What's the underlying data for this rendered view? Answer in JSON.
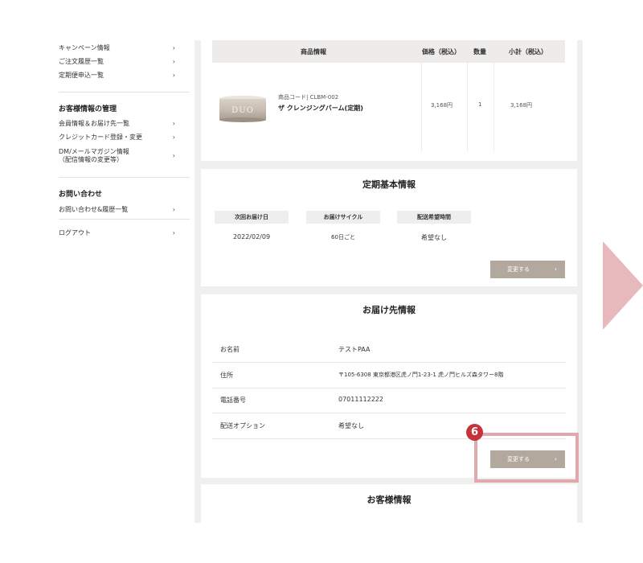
{
  "sidebar": {
    "top_items": [
      {
        "label": "キャンペーン情報",
        "chevron": "›"
      },
      {
        "label": "ご注文履歴一覧",
        "chevron": "›"
      },
      {
        "label": "定期便申込一覧",
        "chevron": "›"
      }
    ],
    "customer_heading": "お客様情報の管理",
    "customer_items": [
      {
        "label": "会員情報＆お届け先一覧",
        "chevron": "›"
      },
      {
        "label": "クレジットカード登録・変更",
        "chevron": "›"
      },
      {
        "label": "DM/メールマガジン情報",
        "sub": "（配信情報の変更等）",
        "chevron": "›"
      }
    ],
    "contact_heading": "お問い合わせ",
    "contact_items": [
      {
        "label": "お問い合わせ&履歴一覧",
        "chevron": "›"
      }
    ],
    "logout": {
      "label": "ログアウト",
      "chevron": "›"
    }
  },
  "product_table": {
    "headers": {
      "info": "商品情報",
      "price": "価格（税込）",
      "qty": "数量",
      "subtotal": "小計（税込）"
    },
    "row": {
      "code": "商品コード| CLBM-002",
      "name": "ザ クレンジングバーム(定期)",
      "price": "3,168円",
      "qty": "1",
      "subtotal": "3,168円",
      "image_brand": "DUO"
    }
  },
  "subscription": {
    "title": "定期基本情報",
    "fields": [
      {
        "label": "次回お届け日",
        "value": "2022/02/09"
      },
      {
        "label": "お届けサイクル",
        "value": "60日ごと"
      },
      {
        "label": "配送希望時間",
        "value": "希望なし"
      }
    ],
    "change_button": "変更する",
    "chevron": "›"
  },
  "delivery": {
    "title": "お届け先情報",
    "rows": [
      {
        "label": "お名前",
        "value": "テストPAA"
      },
      {
        "label": "住所",
        "value": "〒105-6308 東京都港区虎ノ門1-23-1 虎ノ門ヒルズ森タワー8階"
      },
      {
        "label": "電話番号",
        "value": "07011112222"
      },
      {
        "label": "配送オプション",
        "value": "希望なし"
      }
    ],
    "change_button": "変更する",
    "chevron": "›"
  },
  "customer_info": {
    "title": "お客様情報"
  },
  "annotation": {
    "step": "6"
  },
  "colors": {
    "button": "#b2a89e",
    "highlight": "#dfa9ad",
    "badge": "#c6333a",
    "arrow": "#e7b9bd"
  }
}
